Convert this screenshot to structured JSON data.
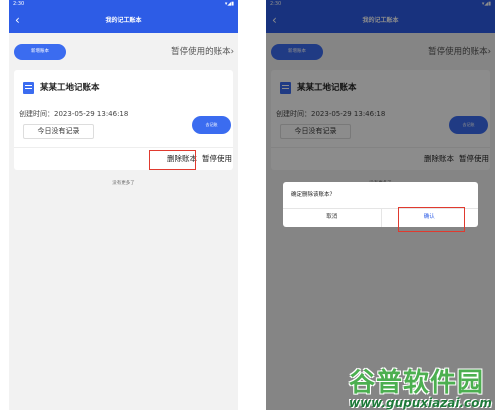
{
  "status_time": "2:30",
  "status_icons": "▾◢▮",
  "page_title": "我的记工账本",
  "back_icon": "‹",
  "new_book_button": "新增账本",
  "paused_books_link": "暂停使用的账本",
  "chevron_right": "›",
  "card": {
    "book_name": "某某工地记账本",
    "created_label": "创建时间：",
    "created_value": "2023-05-29 13:46:18",
    "no_record_today": "今日没有记录",
    "record_button": "去记账",
    "delete_action": "删除账本",
    "pause_action": "暂停使用"
  },
  "no_more": "没有更多了",
  "dialog": {
    "message": "确定删除该账本？",
    "cancel": "取消",
    "confirm": "确认"
  },
  "watermark": {
    "cn": "谷普软件园",
    "url": "www.gupuxiazai.com"
  },
  "colors": {
    "primary": "#2d5ce6",
    "button": "#3b6cf0",
    "highlight": "#e03a2f",
    "watermark_green": "#4caf50"
  }
}
